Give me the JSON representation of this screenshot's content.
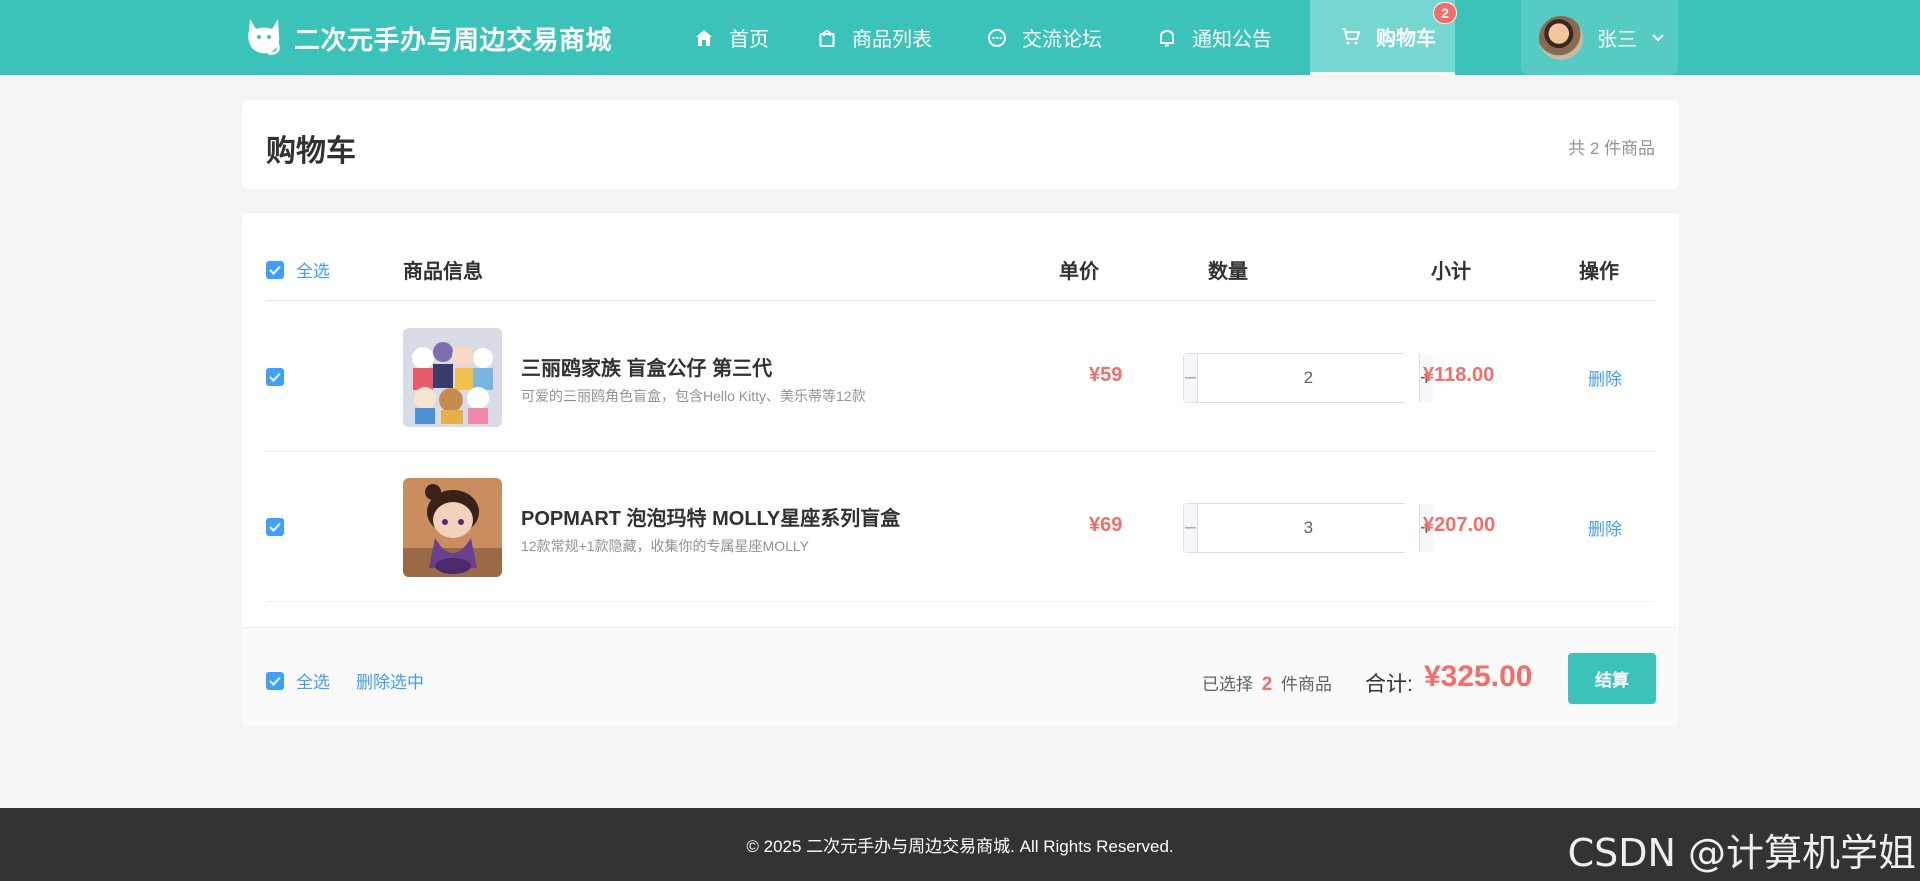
{
  "brand": {
    "title": "二次元手办与周边交易商城",
    "logo_icon": "cat-icon"
  },
  "nav": {
    "items": [
      {
        "label": "首页",
        "icon": "home-icon"
      },
      {
        "label": "商品列表",
        "icon": "shopping-bag-icon"
      },
      {
        "label": "交流论坛",
        "icon": "chat-bubble-icon"
      },
      {
        "label": "通知公告",
        "icon": "bell-icon"
      },
      {
        "label": "购物车",
        "icon": "cart-icon",
        "active": true,
        "badge": "2"
      }
    ]
  },
  "user": {
    "name": "张三",
    "menu_icon": "chevron-down-icon"
  },
  "page": {
    "title": "购物车",
    "item_count": "共 2 件商品"
  },
  "table": {
    "select_all": "全选",
    "headers": [
      "商品信息",
      "单价",
      "数量",
      "小计",
      "操作"
    ]
  },
  "items": [
    {
      "checked": true,
      "name": "三丽鸥家族 盲盒公仔 第三代",
      "desc": "可爱的三丽鸥角色盲盒，包含Hello Kitty、美乐蒂等12款",
      "price": "¥59",
      "quantity": "2",
      "subtotal": "¥118.00",
      "action": "删除"
    },
    {
      "checked": true,
      "name": "POPMART 泡泡玛特 MOLLY星座系列盲盒",
      "desc": "12款常规+1款隐藏，收集你的专属星座MOLLY",
      "price": "¥69",
      "quantity": "3",
      "subtotal": "¥207.00",
      "action": "删除"
    }
  ],
  "summary": {
    "select_all": "全选",
    "delete_selected": "删除选中",
    "selected_prefix": "已选择",
    "selected_count": "2",
    "selected_suffix": "件商品",
    "total_label": "合计:",
    "total": "¥325.00",
    "checkout": "结算"
  },
  "footer": {
    "text": "© 2025 二次元手办与周边交易商城. All Rights Reserved."
  },
  "watermark": "CSDN @计算机学姐",
  "colors": {
    "primary": "#3cc3b9",
    "price": "#f56c6c",
    "link": "#409eff",
    "footer_bg": "#333333"
  }
}
